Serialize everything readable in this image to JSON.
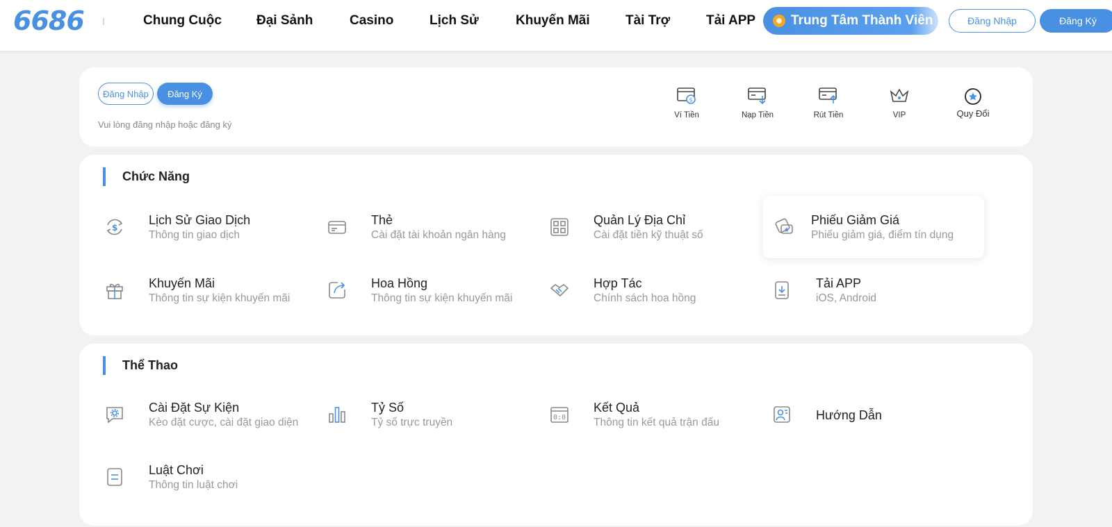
{
  "header": {
    "logo": "6686",
    "nav": [
      "Chung Cuộc",
      "Đại Sảnh",
      "Casino",
      "Lịch Sử",
      "Khuyến Mãi",
      "Tài Trợ",
      "Tải APP"
    ],
    "member_center": "Trung Tâm Thành Viên",
    "login": "Đăng Nhập",
    "register": "Đăng Ký"
  },
  "user_card": {
    "login": "Đăng Nhập",
    "register": "Đăng Ký",
    "hint": "Vui lòng đăng nhập hoặc đăng ký",
    "quick": [
      {
        "label": "Ví Tiền",
        "icon": "wallet-icon"
      },
      {
        "label": "Nạp Tiền",
        "icon": "deposit-icon"
      },
      {
        "label": "Rút Tiền",
        "icon": "withdraw-icon"
      },
      {
        "label": "VIP",
        "icon": "crown-icon"
      },
      {
        "label": "Quy Đổi",
        "icon": "exchange-star-icon"
      }
    ]
  },
  "functions": {
    "title": "Chức Năng",
    "items": [
      {
        "title": "Lịch Sử Giao Dịch",
        "subtitle": "Thông tin giao dịch",
        "icon": "dollar-cycle-icon"
      },
      {
        "title": "Thẻ",
        "subtitle": "Cài đặt tài khoản ngân hàng",
        "icon": "card-icon"
      },
      {
        "title": "Quản Lý Địa Chỉ",
        "subtitle": "Cài đặt tiền kỹ thuật số",
        "icon": "qr-icon"
      },
      {
        "title": "Phiếu Giảm Giá",
        "subtitle": "Phiếu giảm giá, điểm tín dụng",
        "icon": "coupon-icon"
      },
      {
        "title": "Khuyến Mãi",
        "subtitle": "Thông tin sự kiện khuyến mãi",
        "icon": "gift-icon"
      },
      {
        "title": "Hoa Hồng",
        "subtitle": "Thông tin sự kiện khuyến mãi",
        "icon": "share-arrow-icon"
      },
      {
        "title": "Hợp Tác",
        "subtitle": "Chính sách hoa hồng",
        "icon": "handshake-icon"
      },
      {
        "title": "Tải APP",
        "subtitle": "iOS, Android",
        "icon": "download-icon"
      }
    ]
  },
  "sports": {
    "title": "Thể Thao",
    "items": [
      {
        "title": "Cài Đặt Sự Kiện",
        "subtitle": "Kèo đặt cược, cài đặt giao diện",
        "icon": "chat-gear-icon"
      },
      {
        "title": "Tỷ Số",
        "subtitle": "Tỷ số trực truyền",
        "icon": "bar-chart-icon"
      },
      {
        "title": "Kết Quả",
        "subtitle": "Thông tin kết quả trận đấu",
        "icon": "scoreboard-icon"
      },
      {
        "title": "Hướng Dẫn",
        "subtitle": "",
        "icon": "guide-icon"
      },
      {
        "title": "Luật Chơi",
        "subtitle": "Thông tin luật chơi",
        "icon": "rules-icon"
      }
    ]
  },
  "colors": {
    "accent": "#4a90e2",
    "background": "#f2f2f2"
  }
}
